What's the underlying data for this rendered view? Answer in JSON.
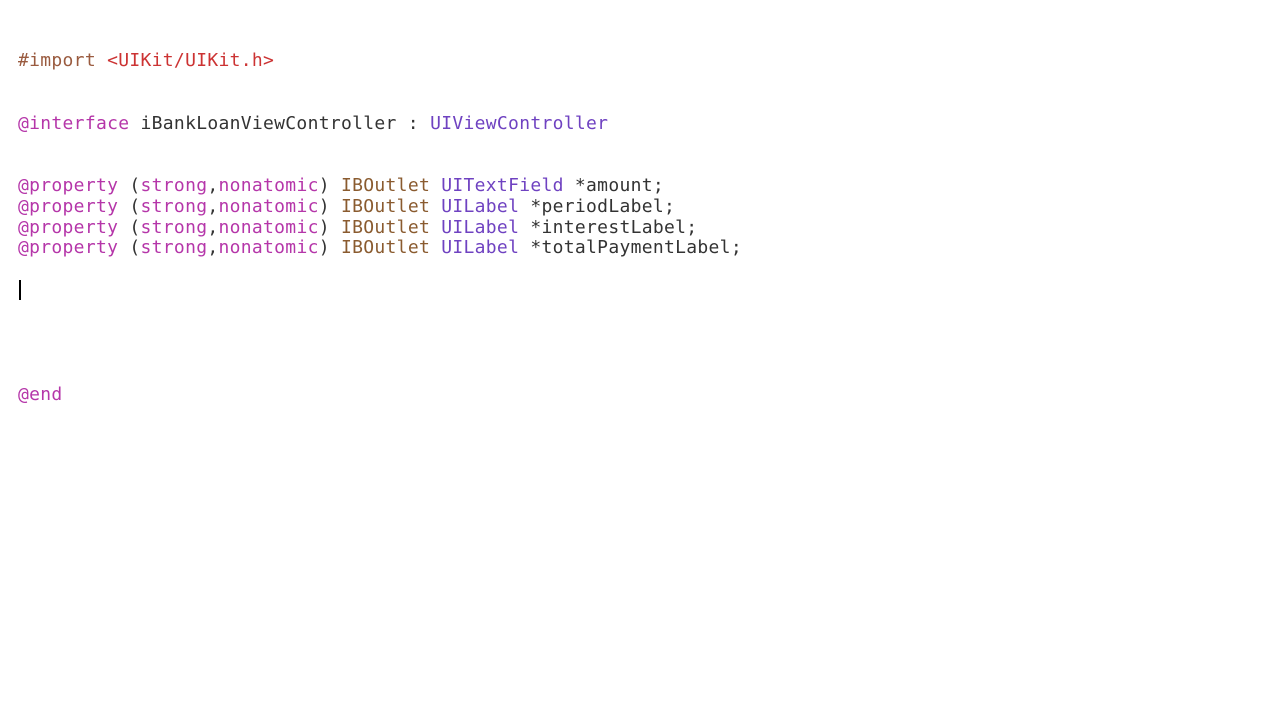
{
  "code": {
    "import": {
      "directive": "#import",
      "path": "<UIKit/UIKit.h>"
    },
    "interface": {
      "keyword": "@interface",
      "className": "iBankLoanViewController",
      "colon": " : ",
      "superclass": "UIViewController"
    },
    "properties": [
      {
        "keyword": "@property",
        "open": " (",
        "attr1": "strong",
        "comma": ",",
        "attr2": "nonatomic",
        "close": ") ",
        "iboutlet": "IBOutlet",
        "space1": " ",
        "type": "UITextField",
        "space2": " ",
        "name": "*amount;"
      },
      {
        "keyword": "@property",
        "open": " (",
        "attr1": "strong",
        "comma": ",",
        "attr2": "nonatomic",
        "close": ") ",
        "iboutlet": "IBOutlet",
        "space1": " ",
        "type": "UILabel",
        "space2": " ",
        "name": "*periodLabel;"
      },
      {
        "keyword": "@property",
        "open": " (",
        "attr1": "strong",
        "comma": ",",
        "attr2": "nonatomic",
        "close": ") ",
        "iboutlet": "IBOutlet",
        "space1": " ",
        "type": "UILabel",
        "space2": " ",
        "name": "*interestLabel;"
      },
      {
        "keyword": "@property",
        "open": " (",
        "attr1": "strong",
        "comma": ",",
        "attr2": "nonatomic",
        "close": ") ",
        "iboutlet": "IBOutlet",
        "space1": " ",
        "type": "UILabel",
        "space2": " ",
        "name": "*totalPaymentLabel;"
      }
    ],
    "end": "@end"
  }
}
